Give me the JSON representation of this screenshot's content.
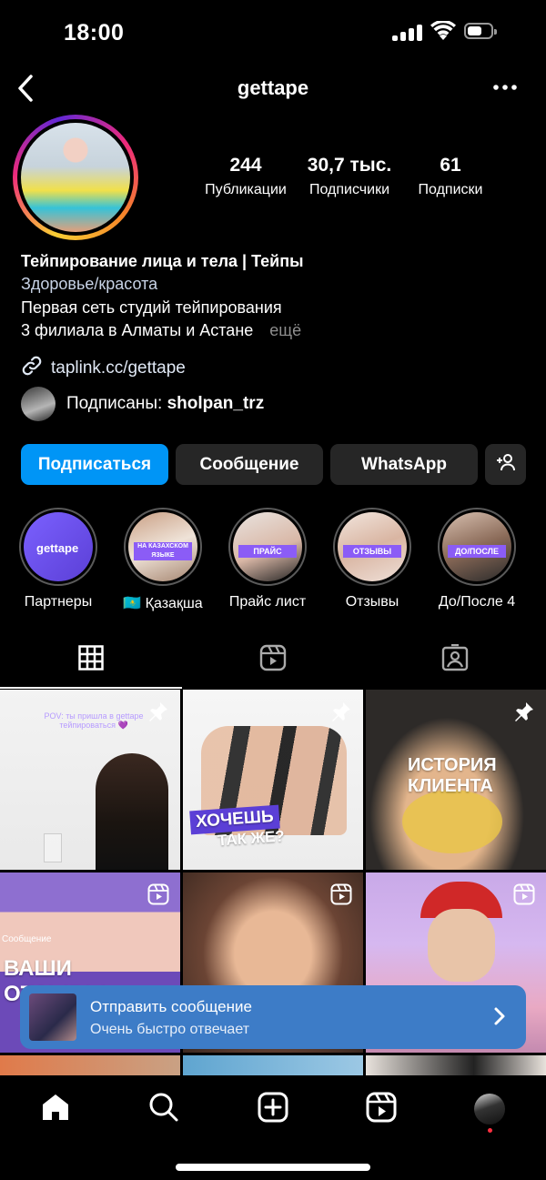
{
  "status": {
    "time": "18:00"
  },
  "header": {
    "username": "gettape"
  },
  "stats": [
    {
      "value": "244",
      "label": "Публикации"
    },
    {
      "value": "30,7 тыс.",
      "label": "Подписчики"
    },
    {
      "value": "61",
      "label": "Подписки"
    }
  ],
  "bio": {
    "name": "Тейпирование лица и тела | Тейпы",
    "category": "Здоровье/красота",
    "line1": "Первая сеть студий тейпирования",
    "line2": "3 филиала в Алматы и Астане",
    "more": "ещё",
    "link": "taplink.cc/gettape",
    "followed_prefix": "Подписаны:",
    "followed_user": "sholpan_trz"
  },
  "buttons": {
    "follow": "Подписаться",
    "message": "Сообщение",
    "whatsapp": "WhatsApp"
  },
  "highlights": [
    {
      "label": "Партнеры",
      "tag": "gettape"
    },
    {
      "label": "🇰🇿 Қазақша",
      "tag": "НА КАЗАХСКОМ ЯЗЫКЕ"
    },
    {
      "label": "Прайс лист",
      "tag": "ПРАЙС"
    },
    {
      "label": "Отзывы",
      "tag": "ОТЗЫВЫ"
    },
    {
      "label": "До/После 4",
      "tag": "ДО/ПОСЛЕ"
    }
  ],
  "posts": {
    "p1_text": "POV: ты пришла в gettape тейпироваться 💜",
    "p2_text1": "ХОЧЕШЬ",
    "p2_text2": "ТАК ЖЕ?",
    "p3_text1": "ИСТОРИЯ",
    "p3_text2": "КЛИЕНТА",
    "p4_small": "Сообщение",
    "p4_text": "ВАШИ ОТЗЫВЫ"
  },
  "banner": {
    "title": "Отправить сообщение",
    "subtitle": "Очень быстро отвечает"
  },
  "colors": {
    "accent": "#0095f6",
    "banner": "#3d7cc7",
    "button": "#262626"
  }
}
